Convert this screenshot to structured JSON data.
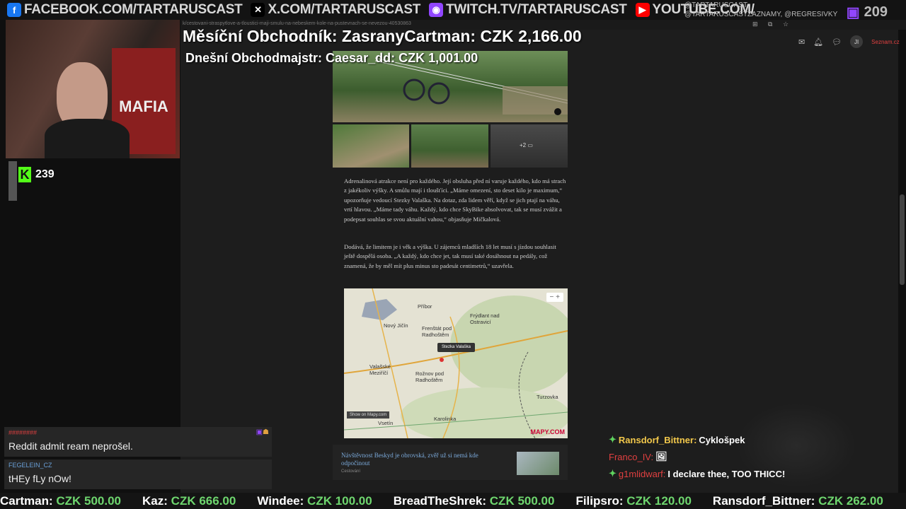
{
  "social": [
    {
      "icon": "facebook-icon",
      "color": "#1877f2",
      "glyph": "f",
      "text": "FACEBOOK.COM/TARTARUSCAST"
    },
    {
      "icon": "x-icon",
      "color": "#000000",
      "glyph": "✕",
      "text": "X.COM/TARTARUSCAST"
    },
    {
      "icon": "twitch-icon",
      "color": "#9146ff",
      "glyph": "◉",
      "text": "TWITCH.TV/TARTARUSCAST"
    },
    {
      "icon": "youtube-icon",
      "color": "#ff0000",
      "glyph": "▶",
      "text": "YOUTUBE.COM/"
    }
  ],
  "handles": "@TARTARUSCAST, @TARTARUSCASTZAZNAMY, @REGRESIVKY",
  "viewer_count": "209",
  "browser": {
    "url": "k/cestovani-straspytlove-a-tloustici-maji-smulu-na-nebeskem-kole-na-pustevnach-se-nevezou-40530863",
    "nav_icons": "⊞ ⧉ ☆"
  },
  "userbar": {
    "avatar_initials": "JI",
    "site": "Seznam.cz"
  },
  "overlay": {
    "monthly": "Měsíční Obchodník: ZasranyCartman: CZK 2,166.00",
    "daily": "Dnešní Obchodmajstr: Caesar_dd: CZK 1,001.00",
    "kick_count": "239",
    "mafia_text": "MAFIA"
  },
  "gallery": {
    "thumb_count": "+2"
  },
  "article": {
    "p1": "Adrenalinová atrakce není pro každého. Její obsluha před ní varuje každého, kdo má strach z jakékoliv výšky. A smůlu mají i tloušťíci. „Máme omezení, sto deset kilo je maximum,“ upozorňuje vedoucí Stezky Valaška. Na dotaz, zda lidem věří, když se jich ptají na váhu, vrtí hlavou. „Máme tady váhu. Každý, kdo chce SkyBike absolvovat, tak se musí zvážit a podepsat souhlas se svou aktuální vahou,“ objasňuje Mičkalová.",
    "p2": "Dodává, že limitem je i věk a výška. U zájemců mladších 18 let musí s jízdou souhlasit ještě dospělá osoba. „A každý, kdo chce jet, tak musí také dosáhnout na pedály, což znamená, že by měl mít plus minus sto padesát centimetrů,“ uzavřela."
  },
  "map": {
    "zoom": "−  +",
    "pin_label": "Stezka Valaška",
    "places": [
      {
        "name": "Příbor"
      },
      {
        "name": "Frýdlant nad Ostravicí"
      },
      {
        "name": "Nový Jičín"
      },
      {
        "name": "Frenštát pod Radhoštěm"
      },
      {
        "name": "Valašské Meziříčí"
      },
      {
        "name": "Rožnov pod Radhoštěm"
      },
      {
        "name": "Turzovka"
      },
      {
        "name": "Karolinka"
      },
      {
        "name": "Vsetín"
      }
    ],
    "show_btn": "Show on Mapy.com",
    "logo": "MAPY.COM"
  },
  "related": {
    "title": "Návštěvnost Beskyd je obrovská, zvěř už si nemá kde odpočinout",
    "source": "Cestování"
  },
  "chat_left": [
    {
      "name": "########",
      "name_color": "#e04040",
      "message": "Reddit admit ream neprošel."
    },
    {
      "name": "FEGELEIN_CZ",
      "name_color": "#6aa0d8",
      "message": "tHEy fLy nOw!"
    }
  ],
  "chat_right": [
    {
      "name": "Ransdorf_Bittner:",
      "name_color": "#f2c84b",
      "message": "Cyklošpek",
      "emote": ""
    },
    {
      "name": "Franco_IV:",
      "name_color": "#e04040",
      "message": "",
      "emote": "🖼"
    },
    {
      "name": "g1mlidwarf:",
      "name_color": "#e04040",
      "message": "I declare thee, TOO THICC!",
      "emote": ""
    }
  ],
  "ticker": [
    {
      "name": "Cartman:",
      "amount": "CZK 500.00"
    },
    {
      "name": "Kaz:",
      "amount": "CZK 666.00"
    },
    {
      "name": "Windee:",
      "amount": "CZK 100.00"
    },
    {
      "name": "BreadTheShrek:",
      "amount": "CZK 500.00"
    },
    {
      "name": "Filipsro:",
      "amount": "CZK 120.00"
    },
    {
      "name": "Ransdorf_Bittner:",
      "amount": "CZK 262.00"
    }
  ]
}
